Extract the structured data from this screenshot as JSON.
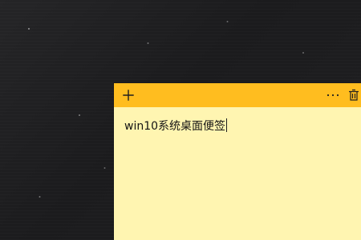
{
  "desktop": {
    "background_color": "#1f1f21"
  },
  "note": {
    "background_color": "#fff5b1",
    "header_color": "#ffbd1f",
    "text": "win10系统桌面便签",
    "icons": {
      "add": "plus-icon",
      "more": "more-options-icon",
      "delete": "trash-icon"
    }
  }
}
